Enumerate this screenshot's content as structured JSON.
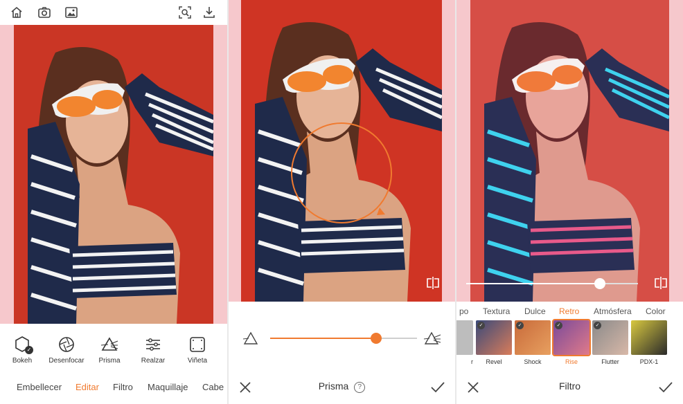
{
  "panel1": {
    "tools": [
      {
        "label": "Bokeh",
        "icon": "hexagon-icon"
      },
      {
        "label": "Desenfocar",
        "icon": "aperture-icon"
      },
      {
        "label": "Prisma",
        "icon": "prism-icon"
      },
      {
        "label": "Realzar",
        "icon": "sliders-icon"
      },
      {
        "label": "Viñeta",
        "icon": "vignette-icon"
      }
    ],
    "tabs": [
      "Embellecer",
      "Editar",
      "Filtro",
      "Maquillaje",
      "Cabe"
    ],
    "active_tab": "Editar"
  },
  "panel2": {
    "title": "Prisma",
    "help": "?",
    "slider_value": 0.72
  },
  "panel3": {
    "title": "Filtro",
    "categories": [
      "po",
      "Textura",
      "Dulce",
      "Retro",
      "Atmósfera",
      "Color"
    ],
    "active_category": "Retro",
    "filters": [
      "r",
      "Revel",
      "Shock",
      "Rise",
      "Flutter",
      "PDX-1"
    ],
    "selected_filter": "Rise",
    "slider_value": 0.78
  },
  "colors": {
    "accent": "#f07a2f",
    "photo_bg": "#d93a2a",
    "pink_bar": "#f6c8cc"
  }
}
